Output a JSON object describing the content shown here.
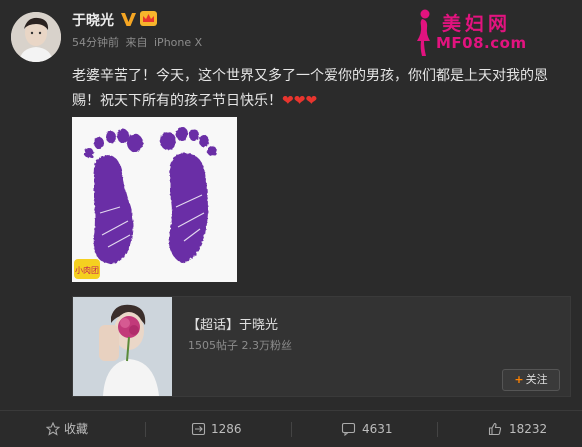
{
  "post": {
    "username": "于晓光",
    "time": "54分钟前",
    "source_prefix": "来自",
    "source": "iPhone X",
    "line1": "老婆辛苦了！今天，这个世界又多了一个爱你的男孩，你们都是上天对我的恩",
    "line2": "赐！祝天下所有的孩子节日快乐！",
    "hearts": "❤❤❤"
  },
  "watermark": {
    "name": "美妇网",
    "url": "MF08.com"
  },
  "photo": {
    "corner_tag": "小肉团"
  },
  "share_card": {
    "title": "【超话】于晓光",
    "stats": "1505帖子 2.3万粉丝",
    "follow_label": "关注",
    "follow_plus": "+"
  },
  "actions": {
    "favorite": "收藏",
    "repost": "1286",
    "comment": "4631",
    "like": "18232"
  },
  "colors": {
    "background": "#2b2b2b",
    "accent_pink": "#e2137f",
    "heart_red": "#e8352e",
    "footprint_purple": "#6a2fa6",
    "follow_orange": "#ff8200"
  }
}
